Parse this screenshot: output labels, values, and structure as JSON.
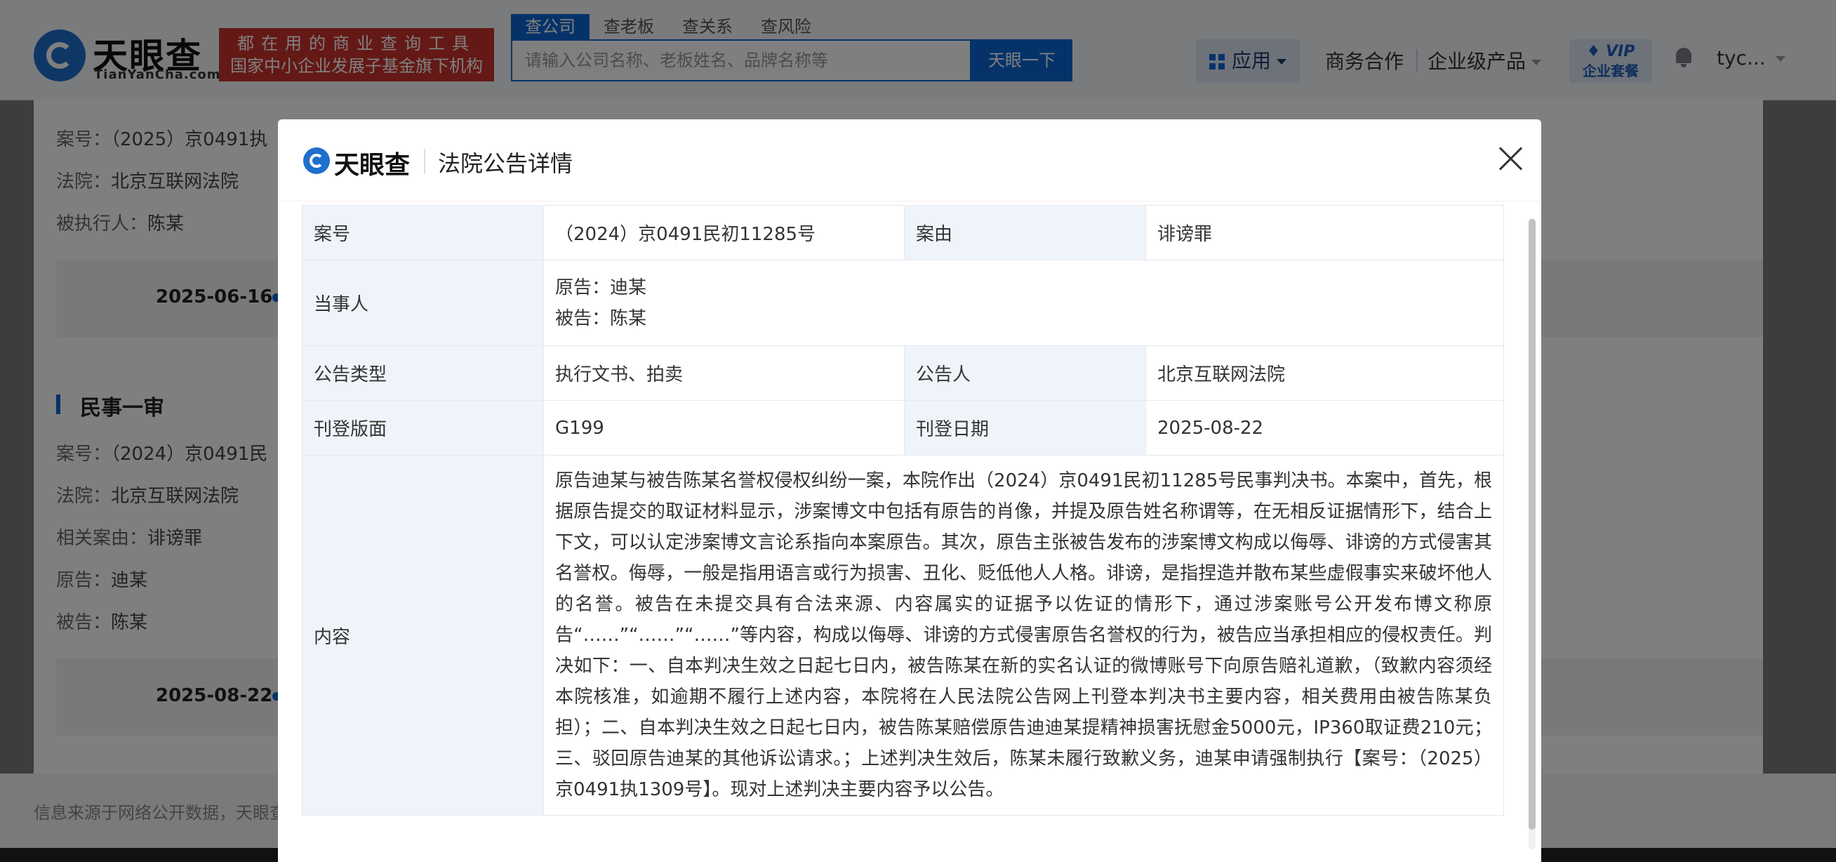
{
  "header": {
    "logo_name": "天眼查",
    "logo_domain": "TianYanCha.com",
    "slogan_line1": "都在用的商业查询工具",
    "slogan_line2": "国家中小企业发展子基金旗下机构",
    "search_tabs": [
      "查公司",
      "查老板",
      "查关系",
      "查风险"
    ],
    "search_placeholder": "请输入公司名称、老板姓名、品牌名称等",
    "search_button": "天眼一下",
    "nav_app": "应用",
    "nav_business": "商务合作",
    "nav_enterprise": "企业级产品",
    "vip_line1": "VIP",
    "vip_line2": "企业套餐",
    "user": "tyc..."
  },
  "background": {
    "case1_no_label": "案号：",
    "case1_no": "（2025）京0491执",
    "case1_court_label": "法院：",
    "case1_court": "北京互联网法院",
    "case1_executed_label": "被执行人：",
    "case1_executed": "陈某",
    "date1": "2025-06-16",
    "section_title": "民事一审",
    "case2_no_label": "案号：",
    "case2_no": "（2024）京0491民",
    "case2_court_label": "法院：",
    "case2_court": "北京互联网法院",
    "case2_reason_label": "相关案由：",
    "case2_reason": "诽谤罪",
    "case2_plaintiff_label": "原告：",
    "case2_plaintiff": "迪某",
    "case2_defendant_label": "被告：",
    "case2_defendant": "陈某",
    "date2": "2025-08-22",
    "footer_text": "信息来源于网络公开数据，天眼查"
  },
  "modal": {
    "logo_name": "天眼查",
    "title": "法院公告详情",
    "rows": {
      "case_no_label": "案号",
      "case_no": "（2024）京0491民初11285号",
      "cause_label": "案由",
      "cause": "诽谤罪",
      "parties_label": "当事人",
      "plaintiff": "原告：迪某",
      "defendant": "被告：陈某",
      "type_label": "公告类型",
      "type": "执行文书、拍卖",
      "announcer_label": "公告人",
      "announcer": "北京互联网法院",
      "page_label": "刊登版面",
      "page": "G199",
      "date_label": "刊登日期",
      "date": "2025-08-22",
      "content_label": "内容",
      "content": "原告迪某与被告陈某名誉权侵权纠纷一案，本院作出（2024）京0491民初11285号民事判决书。本案中，首先，根据原告提交的取证材料显示，涉案博文中包括有原告的肖像，并提及原告姓名称谓等，在无相反证据情形下，结合上下文，可以认定涉案博文言论系指向本案原告。其次，原告主张被告发布的涉案博文构成以侮辱、诽谤的方式侵害其名誉权。侮辱，一般是指用语言或行为损害、丑化、贬低他人人格。诽谤，是指捏造并散布某些虚假事实来破坏他人的名誉。被告在未提交具有合法来源、内容属实的证据予以佐证的情形下，通过涉案账号公开发布博文称原告“……”“……”“……”等内容，构成以侮辱、诽谤的方式侵害原告名誉权的行为，被告应当承担相应的侵权责任。判决如下：一、自本判决生效之日起七日内，被告陈某在新的实名认证的微博账号下向原告赔礼道歉，（致歉内容须经本院核准，如逾期不履行上述内容，本院将在人民法院公告网上刊登本判决书主要内容，相关费用由被告陈某负担）；二、自本判决生效之日起七日内，被告陈某赔偿原告迪迪某提精神损害抚慰金5000元，IP360取证费210元；三、驳回原告迪某的其他诉讼请求。；上述判决生效后，陈某未履行致歉义务，迪某申请强制执行【案号：（2025）京0491执1309号】。现对上述判决主要内容予以公告。"
    }
  },
  "colors": {
    "brand_blue": "#0a67d2",
    "slogan_red": "#c8322d",
    "label_bg": "#eff4fb"
  }
}
